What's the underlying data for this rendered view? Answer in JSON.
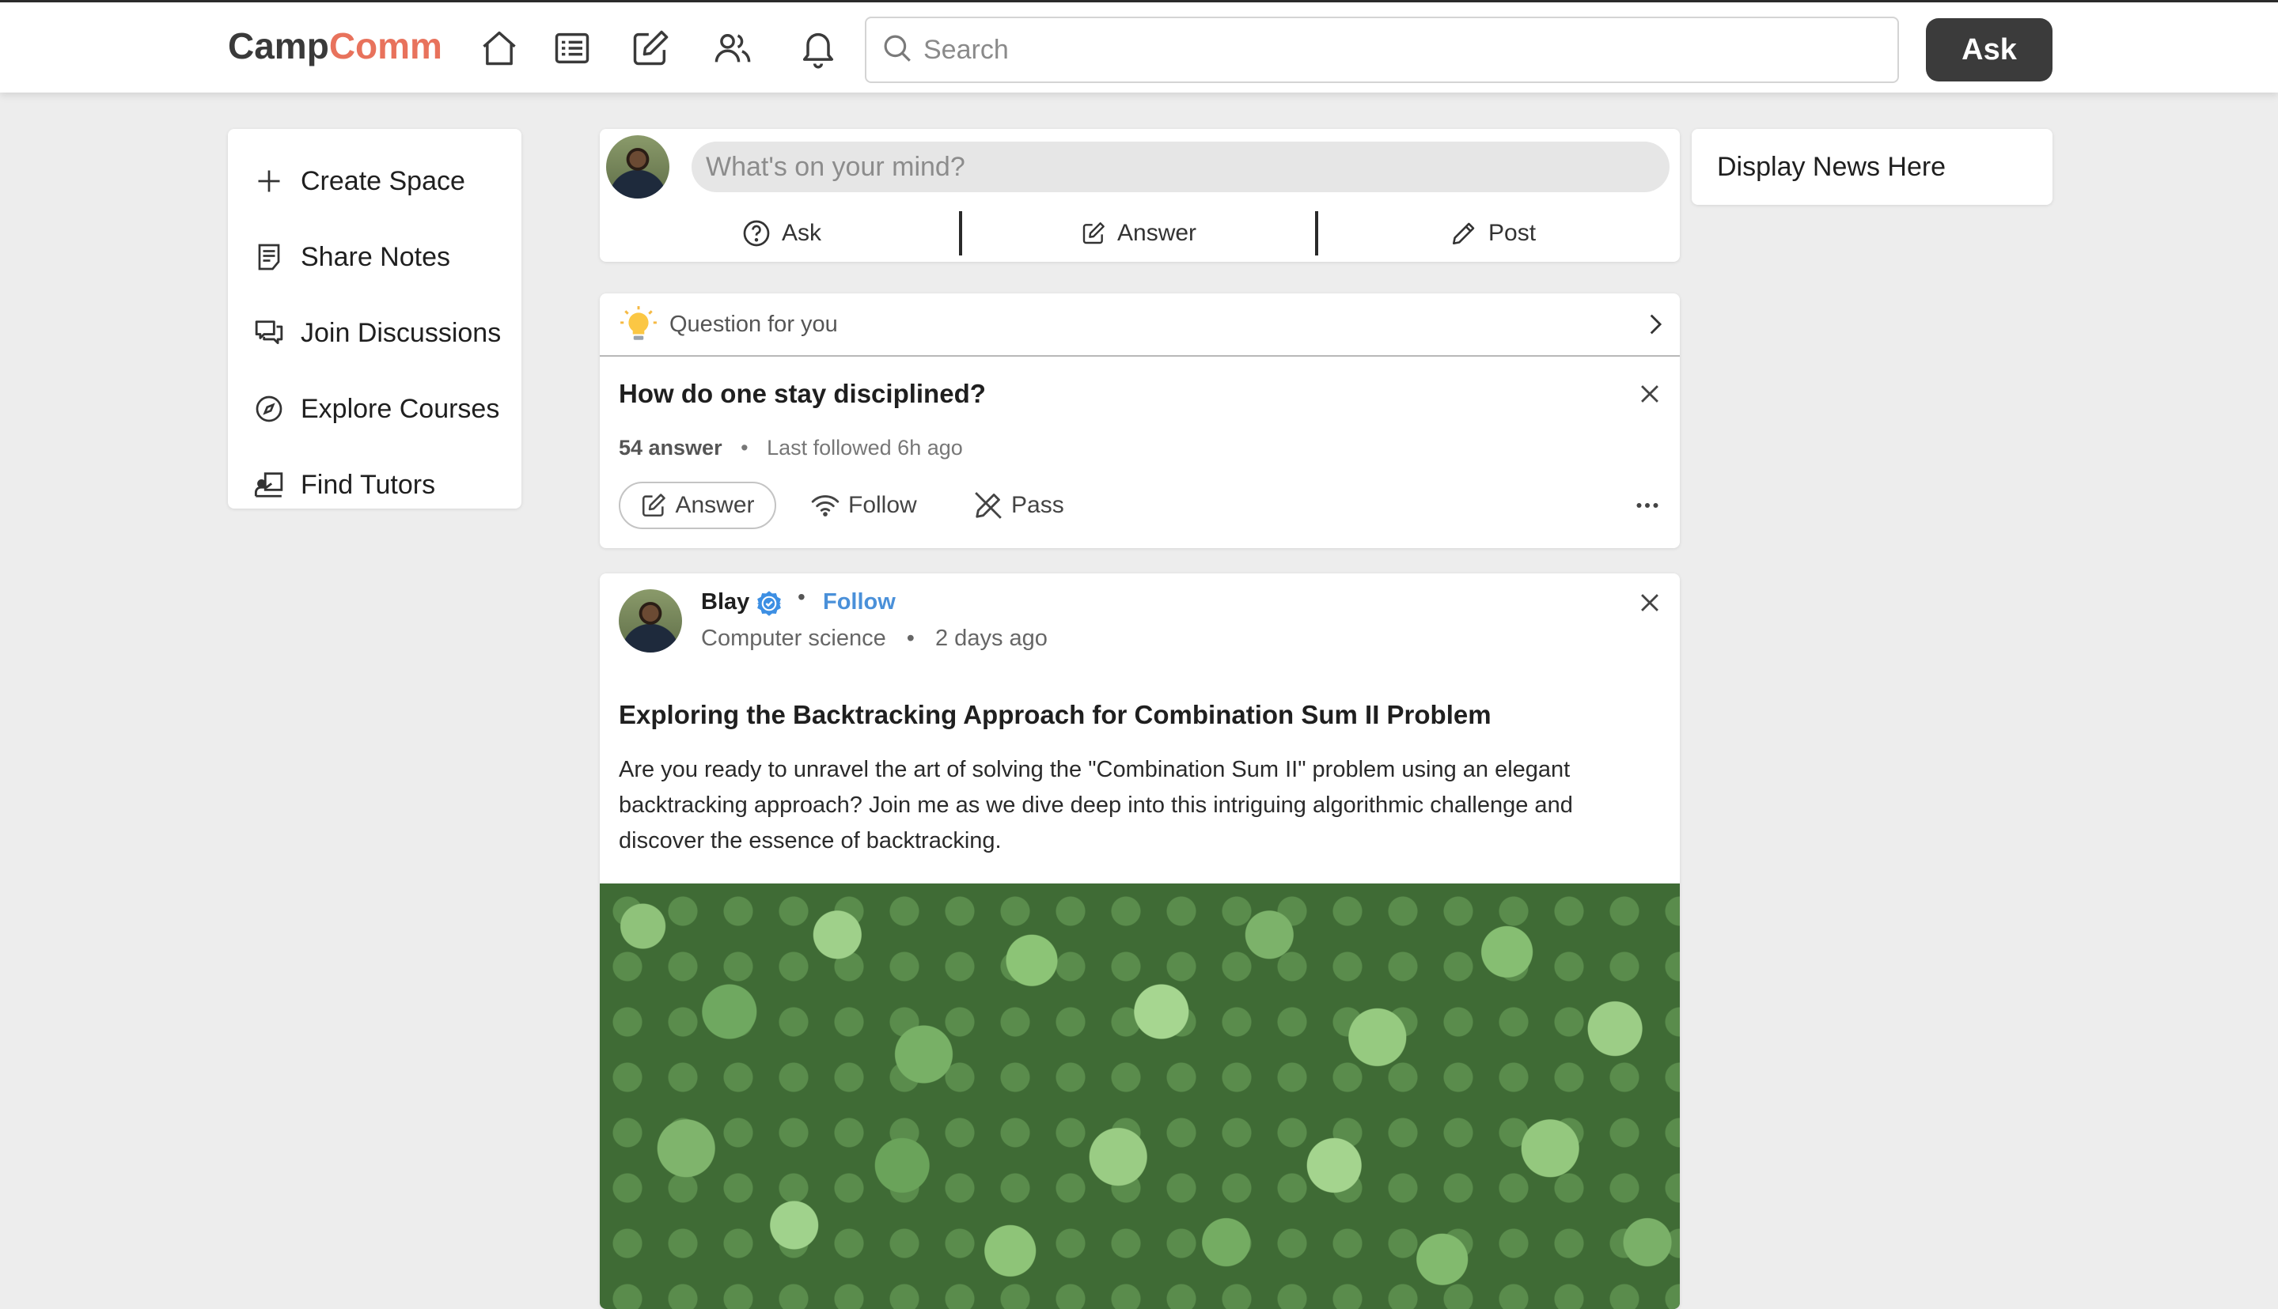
{
  "header": {
    "logo_part1": "Camp",
    "logo_part2": "Comm",
    "search_placeholder": "Search",
    "ask_label": "Ask",
    "nav_icons": [
      "home-icon",
      "list-icon",
      "edit-icon",
      "users-icon",
      "bell-icon"
    ]
  },
  "sidebar": {
    "items": [
      {
        "label": "Create Space",
        "icon": "plus-icon"
      },
      {
        "label": "Share Notes",
        "icon": "notes-icon"
      },
      {
        "label": "Join Discussions",
        "icon": "chat-icon"
      },
      {
        "label": "Explore Courses",
        "icon": "compass-icon"
      },
      {
        "label": "Find Tutors",
        "icon": "tutor-icon"
      }
    ]
  },
  "composer": {
    "placeholder": "What's on your mind?",
    "actions": [
      {
        "label": "Ask",
        "icon": "question-icon"
      },
      {
        "label": "Answer",
        "icon": "edit-icon"
      },
      {
        "label": "Post",
        "icon": "pencil-icon"
      }
    ]
  },
  "question_card": {
    "header": "Question for you",
    "title": "How do one stay disciplined?",
    "answer_count": "54 answer",
    "last_followed": "Last followed 6h ago",
    "answer_label": "Answer",
    "follow_label": "Follow",
    "pass_label": "Pass"
  },
  "post": {
    "author": "Blay",
    "follow_label": "Follow",
    "topic": "Computer science",
    "time": "2 days ago",
    "title": "Exploring the Backtracking Approach for Combination Sum II Problem",
    "body": "Are you ready to unravel the art of solving the \"Combination Sum II\" problem using an elegant backtracking approach? Join me as we dive deep into this intriguing algorithmic challenge and discover the essence of backtracking."
  },
  "news": {
    "label": "Display News Here"
  },
  "colors": {
    "brand_accent": "#e8725c",
    "link_blue": "#4a90d9",
    "ask_button_bg": "#3b3b3b"
  }
}
